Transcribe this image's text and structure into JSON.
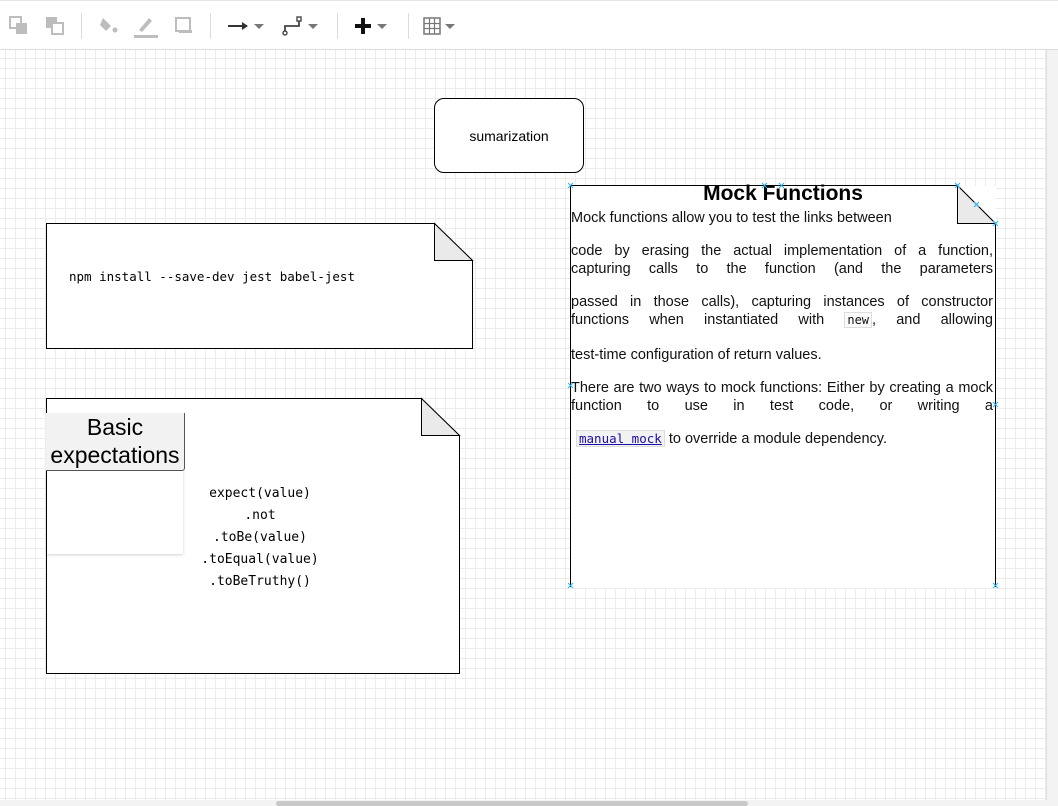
{
  "toolbar": {
    "items": [
      {
        "name": "to-front-icon"
      },
      {
        "name": "to-back-icon"
      },
      {
        "name": "fill-color-icon"
      },
      {
        "name": "line-color-icon"
      },
      {
        "name": "shadow-icon"
      },
      {
        "name": "connection-arrow-icon"
      },
      {
        "name": "waypoints-icon"
      },
      {
        "name": "insert-plus-icon"
      },
      {
        "name": "table-icon"
      }
    ]
  },
  "canvas": {
    "summary_box": {
      "label": "sumarization"
    },
    "npm_note": {
      "command": "npm install --save-dev jest babel-jest"
    },
    "basic_note": {
      "title": "Basic expectations",
      "code": "expect(value)\n.not\n.toBe(value)\n.toEqual(value)\n.toBeTruthy()"
    },
    "mock_note": {
      "title": "Mock Functions",
      "p1": "Mock functions allow you to test the links between",
      "p2": "code by erasing the actual implementation of a function, capturing calls to the function (and the parameters",
      "p3a": " passed in those calls), capturing instances of constructor functions when instantiated with",
      "p3_code": "new",
      "p3b": ", and allowing",
      "p4": "test-time configuration of return values.",
      "p5": "There are two ways to mock functions: Either by creating a mock function to use in test code, or writing a",
      "p6_link": "manual mock",
      "p6b": " to override a module dependency."
    }
  },
  "colors": {
    "selection_handle": "#29b6f2",
    "grid": "#ececec",
    "fold_fill": "#eaeaea"
  }
}
